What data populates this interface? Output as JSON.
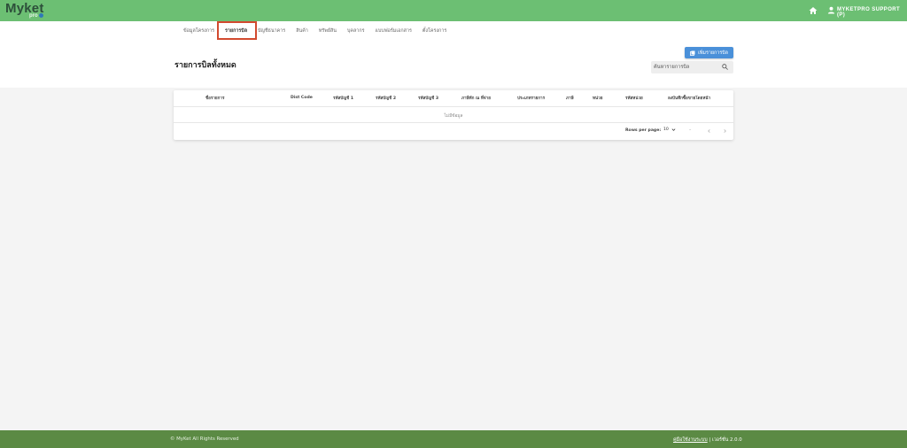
{
  "header": {
    "logo_text": "Myket",
    "logo_sub": "pro",
    "user_label": "MYKETPRO SUPPORT (P)"
  },
  "nav": {
    "items": [
      "ข้อมูลโครงการ",
      "รายการบิล",
      "บัญชีธนาคาร",
      "สินค้า",
      "ทรัพย์สิน",
      "บุคลากร",
      "แบบฟอร์มเอกสาร",
      "ตั้งโครงการ"
    ]
  },
  "page": {
    "title": "รายการบิลทั้งหมด",
    "add_button": "เพิ่มรายการบิล",
    "search_placeholder": "ค้นหารายการบิล"
  },
  "table": {
    "columns": [
      "ชื่อรายการ",
      "Dist Code",
      "รหัสบัญชี 1",
      "รหัสบัญชี 2",
      "รหัสบัญชี 3",
      "ภาษีหัก ณ ที่จ่าย",
      "ประเภทรายการ",
      "ภาษี",
      "หน่วย",
      "รหัสหน่วย",
      "ลงบันทึกซื้อขายโดยหน้า"
    ],
    "empty_text": "ไม่มีข้อมูล",
    "rows_per_page_label": "Rows per page:",
    "rows_per_page_value": "10",
    "range_text": "–"
  },
  "footer": {
    "copyright": "© MyKet All Rights Reserved",
    "doc_link": "คู่มือใช้งานระบบ",
    "version": "| เวอร์ชั่น 2.0.0"
  },
  "colors": {
    "topbar": "#6cbf73",
    "footer": "#5b8a44",
    "accent_button": "#4a90d9",
    "active_highlight": "#d24a2f"
  }
}
